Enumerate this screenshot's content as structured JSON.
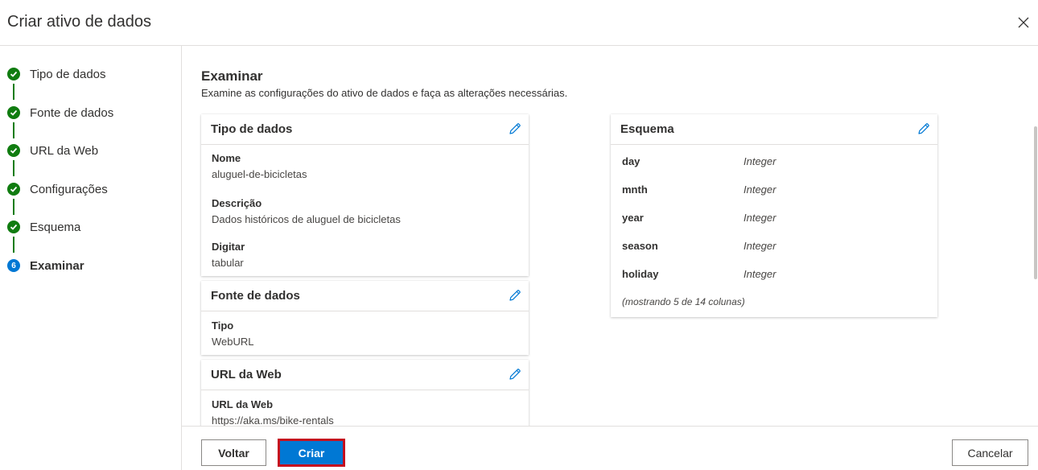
{
  "dialog": {
    "title": "Criar ativo de dados"
  },
  "steps": [
    {
      "label": "Tipo de dados",
      "status": "done"
    },
    {
      "label": "Fonte de dados",
      "status": "done"
    },
    {
      "label": "URL da Web",
      "status": "done"
    },
    {
      "label": "Configurações",
      "status": "done"
    },
    {
      "label": "Esquema",
      "status": "done"
    },
    {
      "label": "Examinar",
      "status": "current",
      "number": "6"
    }
  ],
  "review": {
    "title": "Examinar",
    "subtitle": "Examine as configurações do ativo de dados e faça as alterações necessárias."
  },
  "cards": {
    "data_type": {
      "title": "Tipo de dados",
      "fields": [
        {
          "label": "Nome",
          "value": "aluguel-de-bicicletas"
        },
        {
          "label": "Descrição",
          "value": "Dados históricos de aluguel de bicicletas"
        },
        {
          "label": "Digitar",
          "value": "tabular"
        }
      ]
    },
    "data_source": {
      "title": "Fonte de dados",
      "fields": [
        {
          "label": "Tipo",
          "value": "WebURL"
        }
      ]
    },
    "web_url": {
      "title": "URL da Web",
      "fields": [
        {
          "label": "URL da Web",
          "value": "https://aka.ms/bike-rentals"
        }
      ]
    },
    "schema": {
      "title": "Esquema",
      "rows": [
        {
          "name": "day",
          "type": "Integer"
        },
        {
          "name": "mnth",
          "type": "Integer"
        },
        {
          "name": "year",
          "type": "Integer"
        },
        {
          "name": "season",
          "type": "Integer"
        },
        {
          "name": "holiday",
          "type": "Integer"
        }
      ],
      "note": "(mostrando 5 de 14 colunas)"
    }
  },
  "footer": {
    "back_label": "Voltar",
    "create_label": "Criar",
    "cancel_label": "Cancelar"
  },
  "colors": {
    "primary": "#0078d4",
    "done": "#107c10",
    "highlight": "#c50f1f"
  },
  "icons": {
    "close": "close-icon",
    "edit": "pencil-icon",
    "done": "checkmark-circle-icon"
  }
}
